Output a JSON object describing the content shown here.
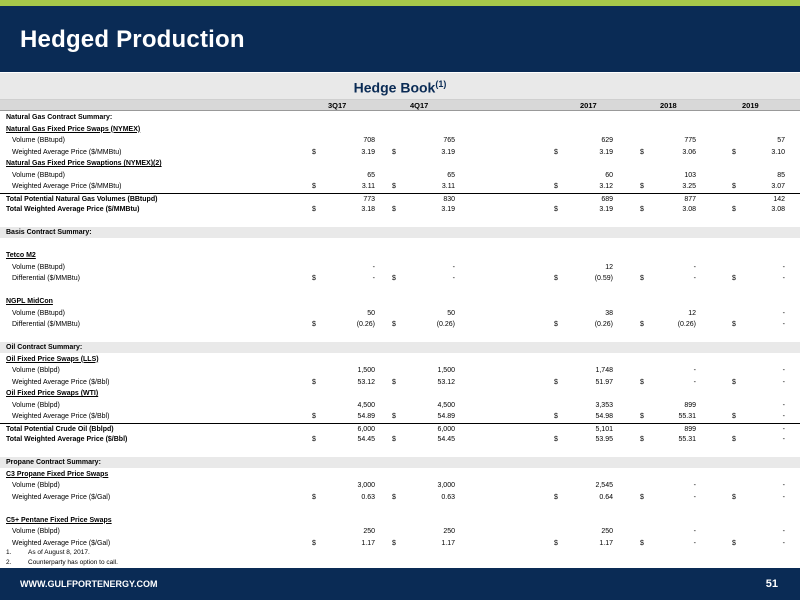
{
  "header": {
    "title": "Hedged Production"
  },
  "hedge_book": {
    "title": "Hedge Book",
    "note_marker": "(1)"
  },
  "columns": [
    "3Q17",
    "4Q17",
    "2017",
    "2018",
    "2019"
  ],
  "rows": [
    {
      "label": "Natural Gas Contract Summary:",
      "style": "bold"
    },
    {
      "label": "Natural Gas Fixed Price Swaps (NYMEX)",
      "style": "bold ul"
    },
    {
      "label": "Volume (BBtupd)",
      "style": "indent",
      "values": [
        "708",
        "765",
        "629",
        "775",
        "57"
      ]
    },
    {
      "label": "Weighted Average Price ($/MMBtu)",
      "style": "indent",
      "dollar": true,
      "values": [
        "3.19",
        "3.19",
        "3.19",
        "3.06",
        "3.10"
      ]
    },
    {
      "label": "Natural Gas Fixed Price Swaptions (NYMEX)(2)",
      "style": "bold ul"
    },
    {
      "label": "Volume (BBtupd)",
      "style": "indent",
      "values": [
        "65",
        "65",
        "60",
        "103",
        "85"
      ]
    },
    {
      "label": "Weighted Average Price ($/MMBtu)",
      "style": "indent",
      "dollar": true,
      "values": [
        "3.11",
        "3.11",
        "3.12",
        "3.25",
        "3.07"
      ]
    },
    {
      "label": "Total Potential Natural Gas Volumes (BBtupd)",
      "style": "bold topline",
      "values": [
        "773",
        "830",
        "689",
        "877",
        "142"
      ]
    },
    {
      "label": "Total Weighted Average Price ($/MMBtu)",
      "style": "bold",
      "dollar": true,
      "values": [
        "3.18",
        "3.19",
        "3.19",
        "3.08",
        "3.08"
      ]
    },
    {
      "label": "",
      "style": ""
    },
    {
      "label": "Basis Contract Summary:",
      "style": "bold section"
    },
    {
      "label": "",
      "style": ""
    },
    {
      "label": "Tetco M2",
      "style": "bold ul"
    },
    {
      "label": "Volume (BBtupd)",
      "style": "indent",
      "values": [
        "-",
        "-",
        "12",
        "-",
        "-"
      ]
    },
    {
      "label": "Differential ($/MMBtu)",
      "style": "indent",
      "dollar": true,
      "values": [
        "-",
        "-",
        "(0.59)",
        "-",
        "-"
      ]
    },
    {
      "label": "",
      "style": ""
    },
    {
      "label": "NGPL MidCon",
      "style": "bold ul"
    },
    {
      "label": "Volume (BBtupd)",
      "style": "indent",
      "values": [
        "50",
        "50",
        "38",
        "12",
        "-"
      ]
    },
    {
      "label": "Differential ($/MMBtu)",
      "style": "indent",
      "dollar": true,
      "values": [
        "(0.26)",
        "(0.26)",
        "(0.26)",
        "(0.26)",
        "-"
      ]
    },
    {
      "label": "",
      "style": ""
    },
    {
      "label": "Oil Contract Summary:",
      "style": "bold section"
    },
    {
      "label": "Oil Fixed Price Swaps (LLS)",
      "style": "bold ul"
    },
    {
      "label": "Volume (Bblpd)",
      "style": "indent",
      "values": [
        "1,500",
        "1,500",
        "1,748",
        "-",
        "-"
      ]
    },
    {
      "label": "Weighted Average Price ($/Bbl)",
      "style": "indent",
      "dollar": true,
      "values": [
        "53.12",
        "53.12",
        "51.97",
        "-",
        "-"
      ]
    },
    {
      "label": "Oil Fixed Price Swaps (WTI)",
      "style": "bold ul"
    },
    {
      "label": "Volume (Bblpd)",
      "style": "indent",
      "values": [
        "4,500",
        "4,500",
        "3,353",
        "899",
        "-"
      ]
    },
    {
      "label": "Weighted Average Price ($/Bbl)",
      "style": "indent",
      "dollar": true,
      "values": [
        "54.89",
        "54.89",
        "54.98",
        "55.31",
        "-"
      ]
    },
    {
      "label": "Total Potential Crude Oil (Bblpd)",
      "style": "bold topline",
      "values": [
        "6,000",
        "6,000",
        "5,101",
        "899",
        "-"
      ]
    },
    {
      "label": "Total Weighted Average Price ($/Bbl)",
      "style": "bold",
      "dollar": true,
      "values": [
        "54.45",
        "54.45",
        "53.95",
        "55.31",
        "-"
      ]
    },
    {
      "label": "",
      "style": ""
    },
    {
      "label": "Propane Contract Summary:",
      "style": "bold section"
    },
    {
      "label": "C3 Propane Fixed Price Swaps",
      "style": "bold ul"
    },
    {
      "label": "Volume (Bblpd)",
      "style": "indent",
      "values": [
        "3,000",
        "3,000",
        "2,545",
        "-",
        "-"
      ]
    },
    {
      "label": "Weighted Average Price ($/Gal)",
      "style": "indent",
      "dollar": true,
      "values": [
        "0.63",
        "0.63",
        "0.64",
        "-",
        "-"
      ]
    },
    {
      "label": "",
      "style": ""
    },
    {
      "label": "C5+ Pentane Fixed Price Swaps",
      "style": "bold ul"
    },
    {
      "label": "Volume (Bblpd)",
      "style": "indent",
      "values": [
        "250",
        "250",
        "250",
        "-",
        "-"
      ]
    },
    {
      "label": "Weighted Average Price ($/Gal)",
      "style": "indent",
      "dollar": true,
      "values": [
        "1.17",
        "1.17",
        "1.17",
        "-",
        "-"
      ]
    }
  ],
  "footnotes": [
    {
      "num": "1.",
      "text": "As of August 8, 2017."
    },
    {
      "num": "2.",
      "text": "Counterparty has option to call."
    }
  ],
  "footer": {
    "url": "WWW.GULFPORTENERGY.COM",
    "page": "51"
  },
  "colors": {
    "navy": "#0a2b55",
    "green": "#a6c84a",
    "gray": "#e9e9e9"
  }
}
